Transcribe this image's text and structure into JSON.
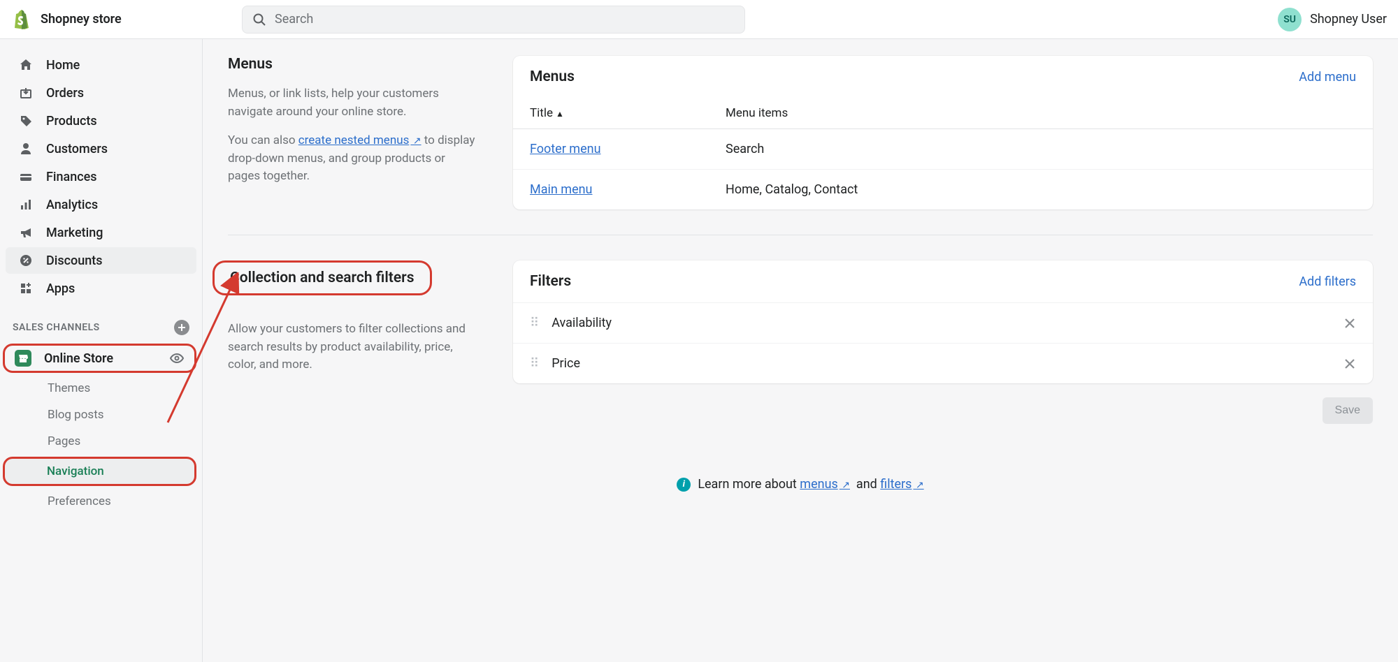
{
  "topbar": {
    "store_name": "Shopney store",
    "search_placeholder": "Search",
    "user_initials": "SU",
    "user_name": "Shopney User"
  },
  "sidebar": {
    "items": [
      {
        "icon": "home",
        "label": "Home"
      },
      {
        "icon": "orders",
        "label": "Orders"
      },
      {
        "icon": "tag",
        "label": "Products"
      },
      {
        "icon": "person",
        "label": "Customers"
      },
      {
        "icon": "finance",
        "label": "Finances"
      },
      {
        "icon": "analytics",
        "label": "Analytics"
      },
      {
        "icon": "marketing",
        "label": "Marketing"
      },
      {
        "icon": "discount",
        "label": "Discounts"
      },
      {
        "icon": "apps",
        "label": "Apps"
      }
    ],
    "channels_header": "SALES CHANNELS",
    "channel": {
      "label": "Online Store"
    },
    "subnav": [
      {
        "label": "Themes"
      },
      {
        "label": "Blog posts"
      },
      {
        "label": "Pages"
      },
      {
        "label": "Navigation"
      },
      {
        "label": "Preferences"
      }
    ]
  },
  "menus_section": {
    "title": "Menus",
    "desc1": "Menus, or link lists, help your customers navigate around your online store.",
    "desc2_pre": "You can also ",
    "desc2_link": "create nested menus",
    "desc2_post": " to display drop-down menus, and group products or pages together."
  },
  "menus_card": {
    "title": "Menus",
    "add_label": "Add menu",
    "col_title": "Title",
    "col_items": "Menu items",
    "rows": [
      {
        "title": "Footer menu",
        "items": "Search"
      },
      {
        "title": "Main menu",
        "items": "Home, Catalog, Contact"
      }
    ]
  },
  "filters_section": {
    "title": "Collection and search filters",
    "desc": "Allow your customers to filter collections and search results by product availability, price, color, and more."
  },
  "filters_card": {
    "title": "Filters",
    "add_label": "Add filters",
    "rows": [
      {
        "label": "Availability"
      },
      {
        "label": "Price"
      }
    ]
  },
  "save_label": "Save",
  "learn_more": {
    "pre": "Learn more about",
    "link1": "menus",
    "mid": "and",
    "link2": "filters"
  }
}
